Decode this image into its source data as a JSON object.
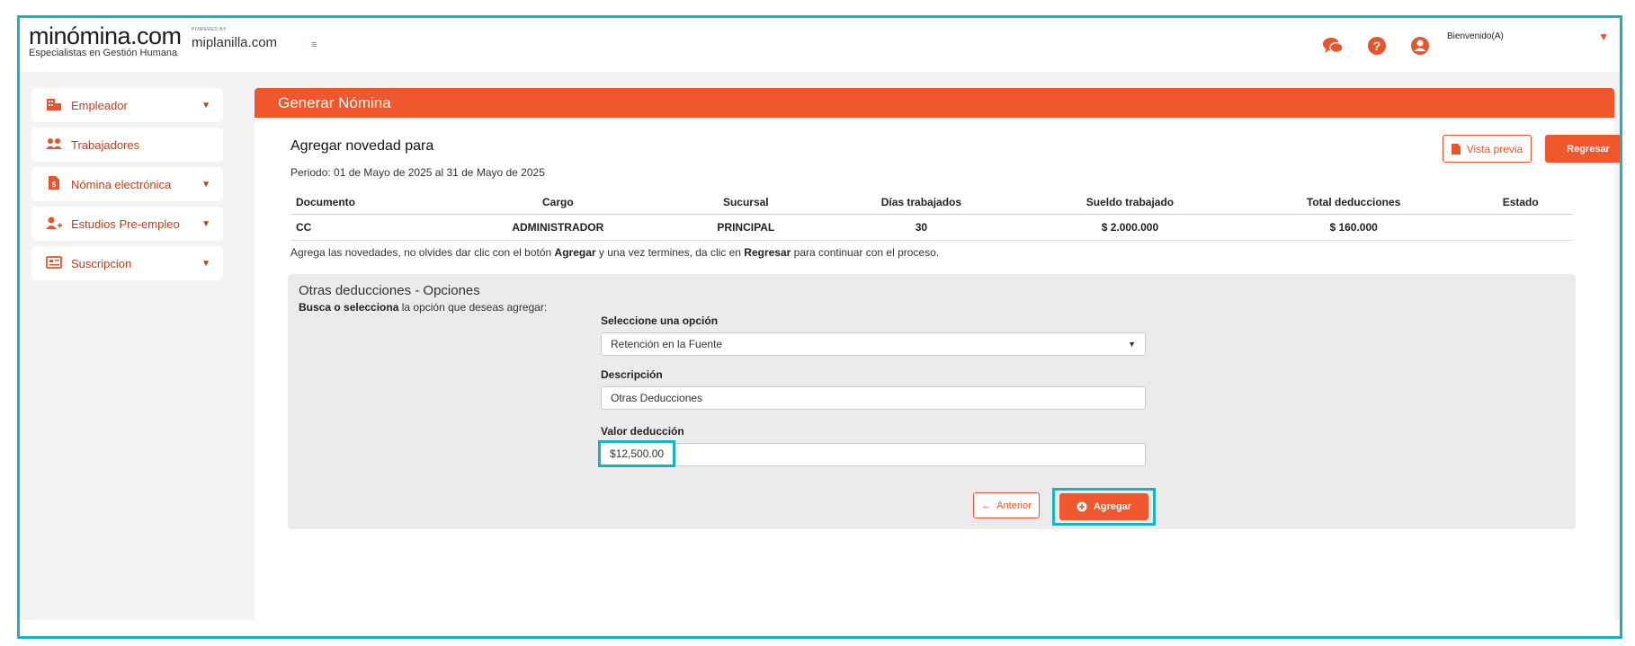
{
  "header": {
    "logo_main": "minómina.com",
    "logo_sub": "Especialistas en Gestión Humana",
    "powered_by": "POWERED BY",
    "powered_brand": "miplanilla.com",
    "welcome": "Bienvenido(A)"
  },
  "sidebar": {
    "items": [
      {
        "label": "Empleador",
        "icon": "building-icon"
      },
      {
        "label": "Trabajadores",
        "icon": "users-icon"
      },
      {
        "label": "Nómina electrónica",
        "icon": "document-icon"
      },
      {
        "label": "Estudios Pre-empleo",
        "icon": "user-plus-icon"
      },
      {
        "label": "Suscripcion",
        "icon": "id-card-icon"
      }
    ]
  },
  "panel": {
    "title": "Generar Nómina",
    "add_title": "Agregar novedad para",
    "period": "Periodo: 01 de Mayo de 2025 al 31 de Mayo de 2025",
    "preview_label": "Vista previa",
    "back_label": "Regresar"
  },
  "table": {
    "headers": [
      "Documento",
      "Cargo",
      "Sucursal",
      "Días trabajados",
      "Sueldo trabajado",
      "Total deducciones",
      "Estado"
    ],
    "row": [
      "CC",
      "ADMINISTRADOR",
      "PRINCIPAL",
      "30",
      "$ 2.000.000",
      "$ 160.000",
      ""
    ]
  },
  "note": {
    "p1": "Agrega las novedades, no olvides dar clic con el botón ",
    "b1": "Agregar",
    "p2": " y una vez termines, da clic en ",
    "b2": "Regresar",
    "p3": " para continuar con el proceso."
  },
  "section": {
    "title": "Otras deducciones - Opciones",
    "sub_bold": "Busca o selecciona",
    "sub_rest": " la opción que deseas agregar:",
    "select_label": "Seleccione una opción",
    "select_value": "Retención en la Fuente",
    "desc_label": "Descripción",
    "desc_value": "Otras Deducciones",
    "value_label": "Valor deducción",
    "value_value": "$12,500.00",
    "prev_label": "Anterior",
    "add_label": "Agregar"
  },
  "colors": {
    "accent": "#f0572c",
    "highlight": "#17b3c1"
  }
}
